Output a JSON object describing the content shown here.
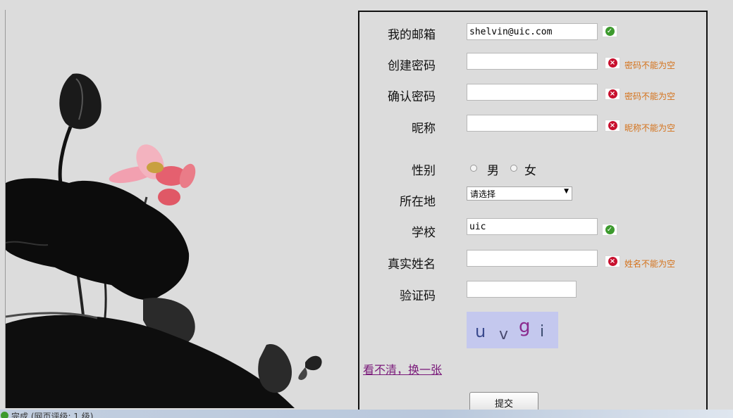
{
  "form": {
    "email_label": "我的邮箱",
    "email_value": "shelvin@uic.com",
    "password_label": "创建密码",
    "password_error": "密码不能为空",
    "confirm_label": "确认密码",
    "confirm_error": "密码不能为空",
    "nickname_label": "昵称",
    "nickname_error": "昵称不能为空",
    "gender_label": "性别",
    "gender_male": "男",
    "gender_female": "女",
    "location_label": "所在地",
    "location_selected": "请选择",
    "school_label": "学校",
    "school_value": "uic",
    "realname_label": "真实姓名",
    "realname_error": "姓名不能为空",
    "captcha_label": "验证码",
    "captcha_chars": [
      "u",
      "v",
      "g",
      "i"
    ],
    "refresh_link": "看不清，换一张",
    "submit_label": "提交"
  },
  "status": {
    "text": "完成 (网页评级: 1 级)"
  },
  "colors": {
    "error_text": "#d4721b",
    "ok_icon": "#3d9a2e",
    "error_icon": "#c8102e",
    "captcha_bg": "#c4c8ee"
  }
}
